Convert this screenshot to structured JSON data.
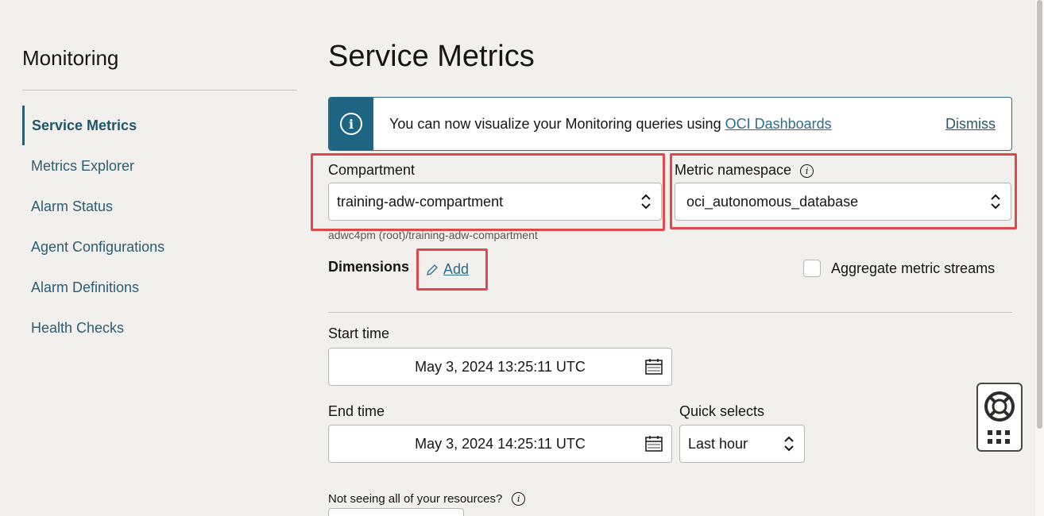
{
  "sidebar": {
    "title": "Monitoring",
    "items": [
      {
        "label": "Service Metrics",
        "active": true
      },
      {
        "label": "Metrics Explorer"
      },
      {
        "label": "Alarm Status"
      },
      {
        "label": "Agent Configurations"
      },
      {
        "label": "Alarm Definitions"
      },
      {
        "label": "Health Checks"
      }
    ]
  },
  "main": {
    "title": "Service Metrics",
    "banner": {
      "text": "You can now visualize your Monitoring queries using ",
      "link": "OCI Dashboards",
      "dismiss": "Dismiss"
    },
    "compartment": {
      "label": "Compartment",
      "value": "training-adw-compartment",
      "path": "adwc4pm (root)/training-adw-compartment"
    },
    "namespace": {
      "label": "Metric namespace",
      "value": "oci_autonomous_database"
    },
    "dimensions": {
      "label": "Dimensions",
      "add": "Add"
    },
    "aggregate": {
      "label": "Aggregate metric streams",
      "checked": false
    },
    "start_time": {
      "label": "Start time",
      "value": "May 3, 2024 13:25:11 UTC"
    },
    "end_time": {
      "label": "End time",
      "value": "May 3, 2024 14:25:11 UTC"
    },
    "quick_selects": {
      "label": "Quick selects",
      "value": "Last hour"
    },
    "not_seeing": "Not seeing all of your resources?"
  },
  "colors": {
    "accent": "#2c6e8a",
    "highlight": "#e0494b",
    "banner_icon_bg": "#1e6583"
  }
}
